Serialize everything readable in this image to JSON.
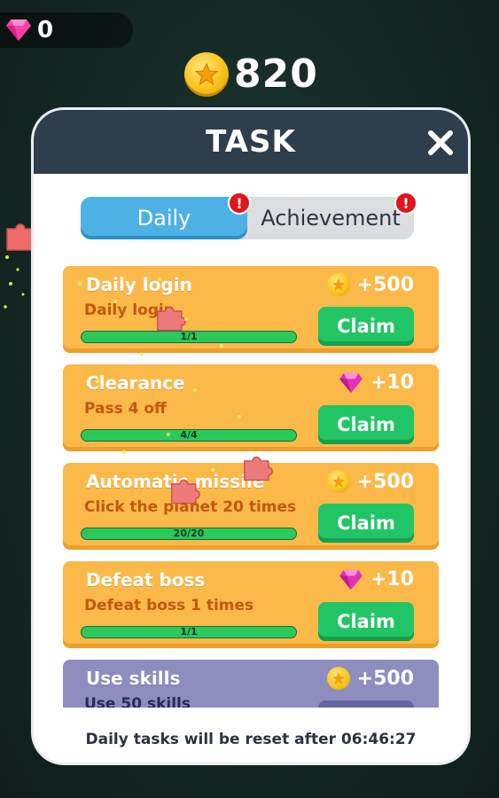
{
  "top_bar": {
    "gem_count": "0",
    "coin_total": "820"
  },
  "modal": {
    "title": "TASK",
    "close_icon": "close-icon",
    "tabs": [
      {
        "label": "Daily",
        "active": true,
        "has_alert": true
      },
      {
        "label": "Achievement",
        "active": false,
        "has_alert": true
      }
    ],
    "alert_mark": "!",
    "tasks": [
      {
        "title": "Daily login",
        "desc": "Daily login",
        "reward_type": "coin",
        "reward": "+500",
        "progress_text": "1/1",
        "progress": 1.0,
        "button": "Claim",
        "theme": "orange"
      },
      {
        "title": "Clearance",
        "desc": "Pass 4 off",
        "reward_type": "gem",
        "reward": "+10",
        "progress_text": "4/4",
        "progress": 1.0,
        "button": "Claim",
        "theme": "orange"
      },
      {
        "title": "Automatic missile",
        "desc": "Click the planet 20 times",
        "reward_type": "coin",
        "reward": "+500",
        "progress_text": "20/20",
        "progress": 1.0,
        "button": "Claim",
        "theme": "orange"
      },
      {
        "title": "Defeat boss",
        "desc": "Defeat boss 1 times",
        "reward_type": "gem",
        "reward": "+10",
        "progress_text": "1/1",
        "progress": 1.0,
        "button": "Claim",
        "theme": "orange"
      },
      {
        "title": "Use skills",
        "desc": "Use 50 skills",
        "reward_type": "coin",
        "reward": "+500",
        "progress_text": "",
        "progress": 0,
        "button": "",
        "theme": "purple"
      }
    ],
    "reset_text": "Daily tasks will be reset after 06:46:27"
  },
  "colors": {
    "header": "#2e3e4c",
    "tab_active": "#4db1e5",
    "task_orange": "#fbb94a",
    "task_purple": "#8d8dc0",
    "claim_green": "#22c566",
    "gem_pink": "#ff3fa8"
  }
}
